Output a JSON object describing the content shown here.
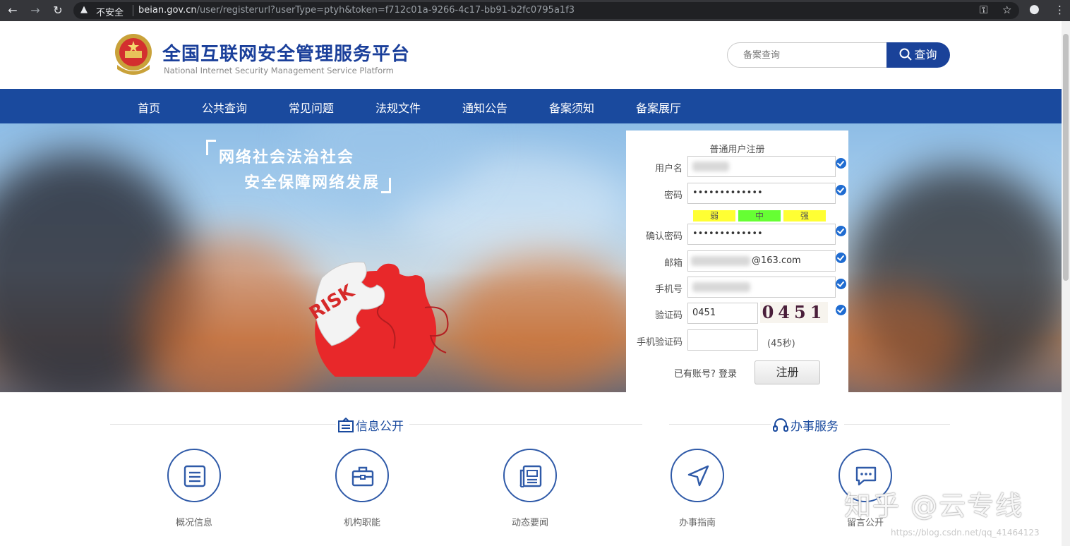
{
  "browser": {
    "insecure_label": "不安全",
    "url_domain": "beian.gov.cn",
    "url_path": "/user/registerurl?userType=ptyh&token=f712c01a-9266-4c17-bb91-b2fc0795a1f3"
  },
  "header": {
    "title": "全国互联网安全管理服务平台",
    "subtitle": "National Internet Security Management Service Platform",
    "search_placeholder": "备案查询",
    "search_button": "查询"
  },
  "nav": {
    "items": [
      "首页",
      "公共查询",
      "常见问题",
      "法规文件",
      "通知公告",
      "备案须知",
      "备案展厅"
    ]
  },
  "banner": {
    "slogan_line1": "网络社会法治社会",
    "slogan_line2": "安全保障网络发展",
    "puzzle_text": "RISK"
  },
  "register": {
    "title": "普通用户注册",
    "username_label": "用户名",
    "password_label": "密码",
    "password_value": "•••••••••••••",
    "strength": [
      "弱",
      "中",
      "强"
    ],
    "confirm_label": "确认密码",
    "confirm_value": "•••••••••••••",
    "email_label": "邮箱",
    "email_suffix": "@163.com",
    "phone_label": "手机号",
    "captcha_label": "验证码",
    "captcha_value": "0451",
    "captcha_image_text": "0451",
    "sms_label": "手机验证码",
    "countdown": "(45秒)",
    "login_hint": "已有账号? 登录",
    "submit": "注册"
  },
  "sections": {
    "info_title": "信息公开",
    "service_title": "办事服务",
    "items": [
      "概况信息",
      "机构职能",
      "动态要闻",
      "办事指南",
      "留言公开"
    ]
  },
  "watermark": {
    "main": "知乎 @云专线",
    "url": "https://blog.csdn.net/qq_41464123"
  },
  "colors": {
    "brand_blue": "#1a4a9e",
    "strength_weak": "#ffff33",
    "strength_medium": "#66ff33",
    "strength_strong": "#ffff33",
    "check_blue": "#1f6cd1"
  }
}
